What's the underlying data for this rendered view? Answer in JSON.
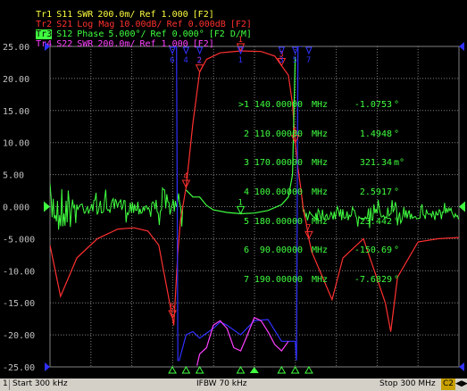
{
  "traces_header": [
    {
      "name": "Tr1",
      "param": "S11",
      "format": "SWR",
      "scale": "200.0m/",
      "ref": "Ref 1.000",
      "window": "[F2]",
      "color": "#ffff40",
      "active": false
    },
    {
      "name": "Tr2",
      "param": "S21",
      "format": "Log Mag",
      "scale": "10.00dB/",
      "ref": "Ref 0.000dB",
      "window": "[F2]",
      "color": "#ff3030",
      "active": false
    },
    {
      "name": "Tr3",
      "param": "S12",
      "format": "Phase",
      "scale": "5.000°/",
      "ref": "Ref 0.000°",
      "window": "[F2 D/M]",
      "color": "#40ff40",
      "active": true
    },
    {
      "name": "Tr4",
      "param": "S22",
      "format": "SWR",
      "scale": "200.0m/",
      "ref": "Ref 1.000",
      "window": "[F2]",
      "color": "#ff40ff",
      "active": false
    }
  ],
  "marker_table": [
    {
      "idx": ">1",
      "freq": "140.00000",
      "unit": "MHz",
      "value": "-1.0753",
      "value_unit": "°"
    },
    {
      "idx": "2",
      "freq": "110.00000",
      "unit": "MHz",
      "value": "1.4948",
      "value_unit": "°"
    },
    {
      "idx": "3",
      "freq": "170.00000",
      "unit": "MHz",
      "value": "321.34",
      "value_unit": "m°"
    },
    {
      "idx": "4",
      "freq": "100.00000",
      "unit": "MHz",
      "value": "2.5917",
      "value_unit": "°"
    },
    {
      "idx": "5",
      "freq": "180.00000",
      "unit": "MHz",
      "value": "23.442",
      "value_unit": "°"
    },
    {
      "idx": "6",
      "freq": "90.00000",
      "unit": "MHz",
      "value": "-150.69",
      "value_unit": "°"
    },
    {
      "idx": "7",
      "freq": "190.00000",
      "unit": "MHz",
      "value": "-7.6829",
      "value_unit": "°"
    }
  ],
  "status": {
    "channel": "1",
    "start": "Start 300 kHz",
    "ifbw": "IFBW 70 kHz",
    "stop": "Stop 300 MHz",
    "cal": "C2"
  },
  "colors": {
    "background": "#000000",
    "grid": "#7f7f7f",
    "s11": "#ffff40",
    "s21": "#ff3030",
    "s12": "#40ff40",
    "s22": "#ff40ff",
    "blue": "#3030ff",
    "status_bg": "#d4d0c8"
  },
  "chart_data": {
    "type": "line",
    "title": "",
    "xlabel": "",
    "ylabel": "",
    "xlim_mhz": [
      0.3,
      300
    ],
    "ylim": [
      -25,
      25
    ],
    "y_ticks": [
      "25.00",
      "20.00",
      "15.00",
      "10.00",
      "5.00",
      "0.000",
      "-5.000",
      "-10.00",
      "-15.00",
      "-20.00",
      "-25.00"
    ],
    "grid": true,
    "reference_level": 0,
    "series": [
      {
        "name": "S21",
        "color": "#ff3030",
        "unit": "dB",
        "x": [
          0.3,
          8,
          20,
          35,
          50,
          62,
          72,
          80,
          88,
          91,
          94,
          96,
          100,
          105,
          110,
          115,
          125,
          140,
          155,
          165,
          170,
          175,
          178,
          180,
          182,
          184,
          186,
          188,
          190,
          192,
          200,
          207,
          215,
          230,
          246,
          250,
          255,
          270,
          285,
          300
        ],
        "y": [
          -6.0,
          -14.0,
          -8.0,
          -5.0,
          -3.5,
          -3.3,
          -3.8,
          -6.0,
          -15.0,
          -18.5,
          -7.0,
          -2.0,
          3.0,
          13.0,
          21.0,
          23.0,
          24.0,
          24.3,
          24.2,
          23.5,
          22.0,
          20.5,
          16.0,
          10.0,
          6.0,
          3.0,
          -0.5,
          -2.5,
          -5.0,
          -7.0,
          -11.0,
          -14.5,
          -8.0,
          -5.0,
          -15.0,
          -19.5,
          -11.0,
          -5.5,
          -5.0,
          -4.8
        ]
      },
      {
        "name": "S12",
        "color": "#40ff40",
        "unit": "deg",
        "x": [
          100,
          105,
          110,
          115,
          120,
          130,
          140,
          150,
          160,
          170,
          175,
          178,
          180
        ],
        "y": [
          2.6,
          1.5,
          1.5,
          0.2,
          -0.5,
          -0.9,
          -1.1,
          -1.0,
          -0.6,
          0.3,
          1.5,
          5.0,
          23.4
        ]
      },
      {
        "name": "S11",
        "color": "#3030ff",
        "unit": "",
        "x": [
          90,
          91,
          92,
          93,
          94,
          95,
          100,
          105,
          110,
          120,
          125,
          130,
          140,
          150,
          160,
          170,
          180,
          181,
          182,
          183,
          184,
          185
        ],
        "y": [
          25,
          25,
          25,
          25,
          -24,
          -24,
          -20,
          -19.5,
          -20.5,
          -19.0,
          -18.0,
          -18.5,
          -20.0,
          -17.8,
          -17.6,
          -21.0,
          -21.0,
          -24,
          25,
          25,
          25,
          25
        ]
      },
      {
        "name": "S22",
        "color": "#ff40ff",
        "unit": "",
        "x": [
          108,
          110,
          115,
          120,
          125,
          130,
          135,
          140,
          145,
          150,
          155,
          160,
          165,
          170,
          175
        ],
        "y": [
          -24.8,
          -23.0,
          -22.0,
          -18.5,
          -17.8,
          -19.0,
          -22.0,
          -22.5,
          -20.0,
          -17.3,
          -17.8,
          -19.5,
          -21.5,
          -22.5,
          -21.0
        ]
      }
    ],
    "markers": [
      {
        "id": "1",
        "x": 140,
        "label": "1"
      },
      {
        "id": "2",
        "x": 110,
        "label": "2"
      },
      {
        "id": "3",
        "x": 170,
        "label": "3"
      },
      {
        "id": "4",
        "x": 100,
        "label": "4"
      },
      {
        "id": "5",
        "x": 180,
        "label": "5"
      },
      {
        "id": "6",
        "x": 90,
        "label": "6"
      },
      {
        "id": "7",
        "x": 190,
        "label": "7"
      }
    ]
  }
}
